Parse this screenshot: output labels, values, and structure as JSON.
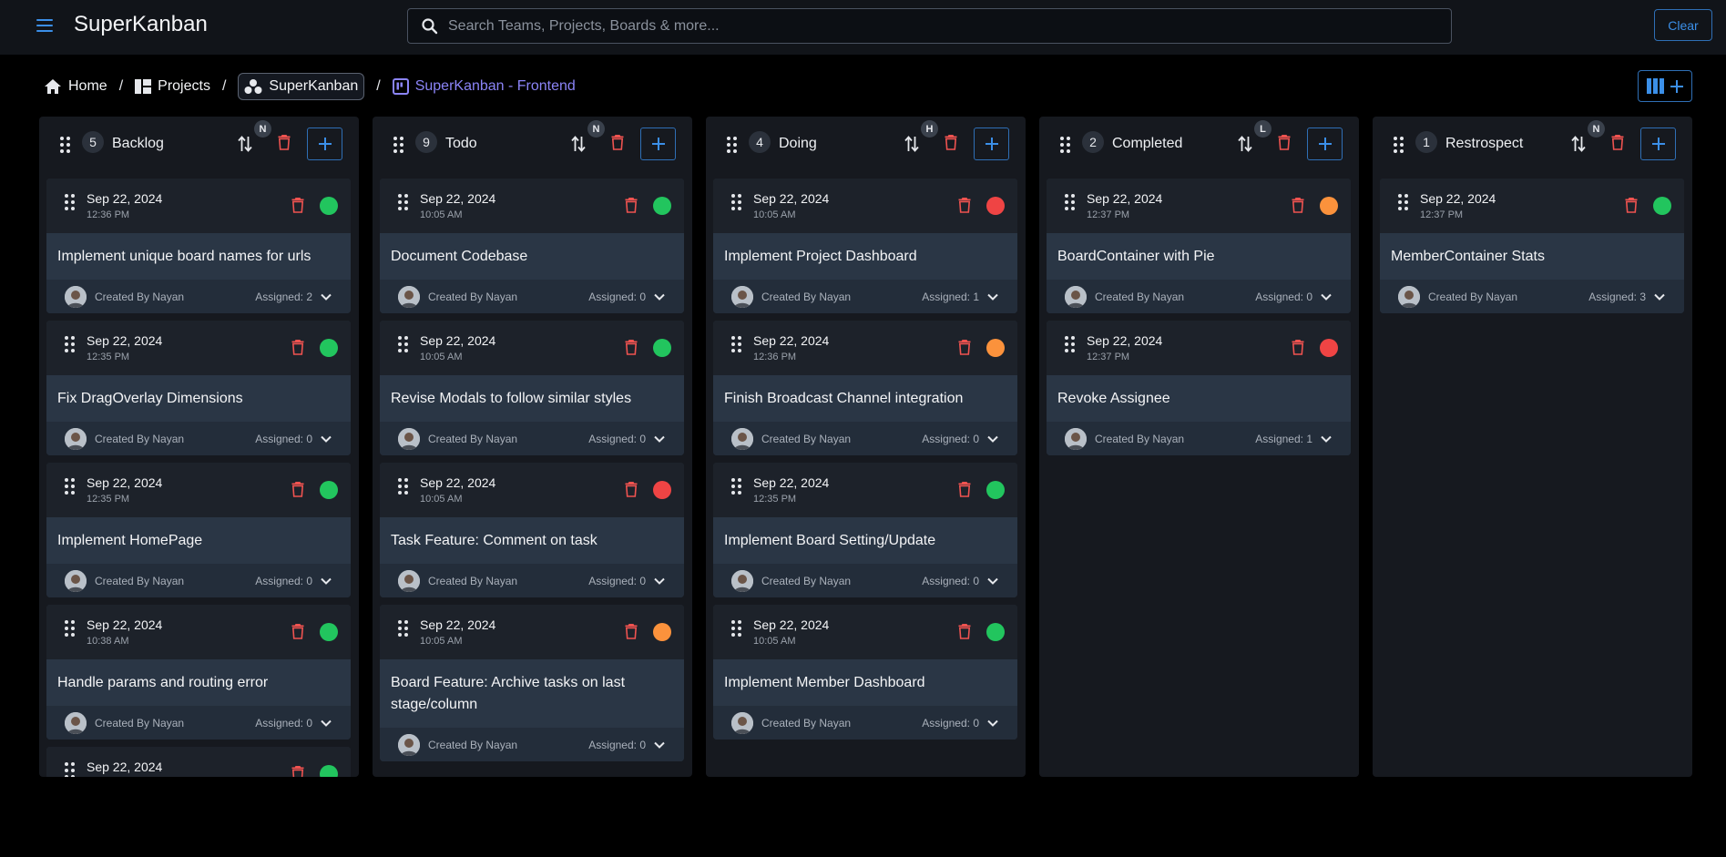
{
  "header": {
    "app_title": "SuperKanban",
    "search_placeholder": "Search Teams, Projects, Boards & more...",
    "clear_label": "Clear"
  },
  "breadcrumb": {
    "home": "Home",
    "projects": "Projects",
    "team": "SuperKanban",
    "board": "SuperKanban - Frontend"
  },
  "colors": {
    "accent": "#3b8fe8",
    "board_link": "#8b84f7",
    "delete": "#ef5350",
    "status_green": "#22c55e",
    "status_red": "#ef4444",
    "status_orange": "#fb923c"
  },
  "columns": [
    {
      "count": "5",
      "title": "Backlog",
      "priority": "N",
      "cards": [
        {
          "date": "Sep 22, 2024",
          "time": "12:36 PM",
          "title": "Implement unique board names for urls",
          "created": "Created By Nayan",
          "assigned": "Assigned: 2",
          "status": "green"
        },
        {
          "date": "Sep 22, 2024",
          "time": "12:35 PM",
          "title": "Fix DragOverlay Dimensions",
          "created": "Created By Nayan",
          "assigned": "Assigned: 0",
          "status": "green"
        },
        {
          "date": "Sep 22, 2024",
          "time": "12:35 PM",
          "title": "Implement HomePage",
          "created": "Created By Nayan",
          "assigned": "Assigned: 0",
          "status": "green"
        },
        {
          "date": "Sep 22, 2024",
          "time": "10:38 AM",
          "title": "Handle params and routing error",
          "created": "Created By Nayan",
          "assigned": "Assigned: 0",
          "status": "green"
        },
        {
          "date": "Sep 22, 2024",
          "time": "",
          "title": "",
          "created": "",
          "assigned": "",
          "status": "green"
        }
      ]
    },
    {
      "count": "9",
      "title": "Todo",
      "priority": "N",
      "cards": [
        {
          "date": "Sep 22, 2024",
          "time": "10:05 AM",
          "title": "Document Codebase",
          "created": "Created By Nayan",
          "assigned": "Assigned: 0",
          "status": "green"
        },
        {
          "date": "Sep 22, 2024",
          "time": "10:05 AM",
          "title": "Revise Modals to follow similar styles",
          "created": "Created By Nayan",
          "assigned": "Assigned: 0",
          "status": "green"
        },
        {
          "date": "Sep 22, 2024",
          "time": "10:05 AM",
          "title": "Task Feature: Comment on task",
          "created": "Created By Nayan",
          "assigned": "Assigned: 0",
          "status": "red"
        },
        {
          "date": "Sep 22, 2024",
          "time": "10:05 AM",
          "title": "Board Feature: Archive tasks on last stage/column",
          "created": "Created By Nayan",
          "assigned": "Assigned: 0",
          "status": "orange"
        }
      ]
    },
    {
      "count": "4",
      "title": "Doing",
      "priority": "H",
      "cards": [
        {
          "date": "Sep 22, 2024",
          "time": "10:05 AM",
          "title": "Implement Project Dashboard",
          "created": "Created By Nayan",
          "assigned": "Assigned: 1",
          "status": "red"
        },
        {
          "date": "Sep 22, 2024",
          "time": "12:36 PM",
          "title": "Finish Broadcast Channel integration",
          "created": "Created By Nayan",
          "assigned": "Assigned: 0",
          "status": "orange"
        },
        {
          "date": "Sep 22, 2024",
          "time": "12:35 PM",
          "title": "Implement Board Setting/Update",
          "created": "Created By Nayan",
          "assigned": "Assigned: 0",
          "status": "green"
        },
        {
          "date": "Sep 22, 2024",
          "time": "10:05 AM",
          "title": "Implement Member Dashboard",
          "created": "Created By Nayan",
          "assigned": "Assigned: 0",
          "status": "green"
        }
      ]
    },
    {
      "count": "2",
      "title": "Completed",
      "priority": "L",
      "cards": [
        {
          "date": "Sep 22, 2024",
          "time": "12:37 PM",
          "title": "BoardContainer with Pie",
          "created": "Created By Nayan",
          "assigned": "Assigned: 0",
          "status": "orange"
        },
        {
          "date": "Sep 22, 2024",
          "time": "12:37 PM",
          "title": "Revoke Assignee",
          "created": "Created By Nayan",
          "assigned": "Assigned: 1",
          "status": "red"
        }
      ]
    },
    {
      "count": "1",
      "title": "Restrospect",
      "priority": "N",
      "cards": [
        {
          "date": "Sep 22, 2024",
          "time": "12:37 PM",
          "title": "MemberContainer Stats",
          "created": "Created By Nayan",
          "assigned": "Assigned: 3",
          "status": "green"
        }
      ]
    }
  ]
}
